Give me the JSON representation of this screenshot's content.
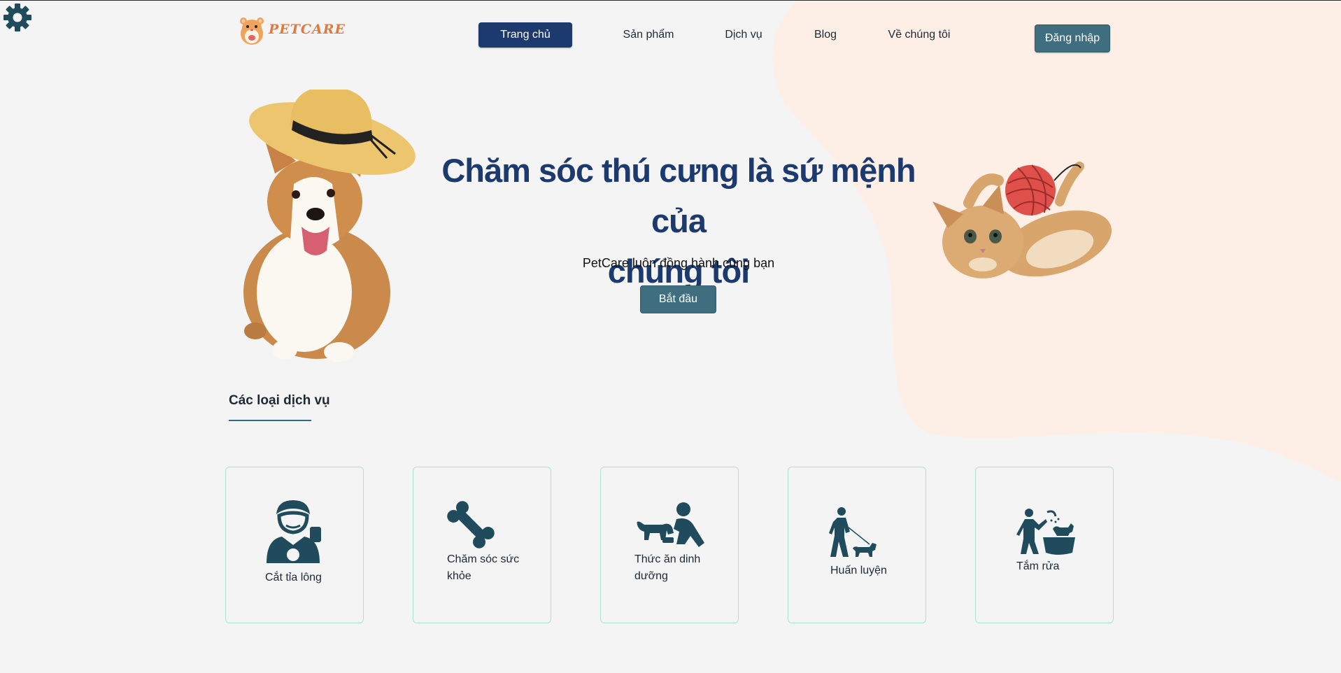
{
  "brand": {
    "logo_text": "PETCARE"
  },
  "nav": {
    "items": [
      {
        "label": "Trang chủ",
        "active": true
      },
      {
        "label": "Sản phẩm",
        "active": false
      },
      {
        "label": "Dịch vụ",
        "active": false
      },
      {
        "label": "Blog",
        "active": false
      },
      {
        "label": "Về chúng tôi",
        "active": false
      }
    ],
    "login_label": "Đăng nhập"
  },
  "hero": {
    "title_line1": "Chăm sóc thú cưng là sứ mệnh của",
    "title_line2": "chúng tôi",
    "subtitle": "PetCare luôn đồng hành cùng bạn",
    "cta_label": "Bắt đầu"
  },
  "services": {
    "title": "Các loại dịch vụ",
    "items": [
      {
        "label": "Cắt tỉa lông",
        "icon": "groomer-icon"
      },
      {
        "label": "Chăm sóc sức khỏe",
        "icon": "bone-icon"
      },
      {
        "label": "Thức ăn dinh dưỡng",
        "icon": "feeding-dog-icon"
      },
      {
        "label": "Huấn luyện",
        "icon": "dog-walking-icon"
      },
      {
        "label": "Tắm rửa",
        "icon": "dog-bathing-icon"
      }
    ]
  },
  "colors": {
    "primary_dark": "#1c3a6e",
    "button_teal": "#3f6e7f",
    "icon_teal": "#1f4b5c",
    "blob_peach": "#fdeee6",
    "card_border": "#a9e6cf"
  }
}
